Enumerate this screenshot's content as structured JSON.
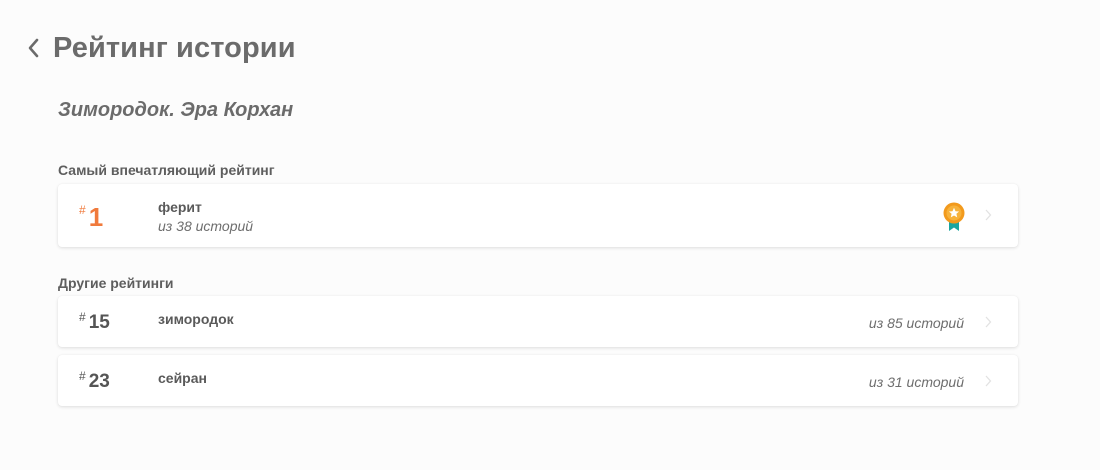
{
  "header": {
    "title": "Рейтинг истории",
    "back_icon": "chevron-left-icon"
  },
  "story": {
    "title": "Зимородок. Эра Корхан"
  },
  "top_section": {
    "label": "Самый впечатляющий рейтинг",
    "item": {
      "hash": "#",
      "rank": "1",
      "name": "ферит",
      "count": "из 38 историй",
      "badge_icon": "medal-icon",
      "accent_color": "#f07a3c"
    }
  },
  "other_section": {
    "label": "Другие рейтинги",
    "items": [
      {
        "hash": "#",
        "rank": "15",
        "name": "зимородок",
        "count": "из 85 историй"
      },
      {
        "hash": "#",
        "rank": "23",
        "name": "сейран",
        "count": "из 31 историй"
      }
    ]
  }
}
